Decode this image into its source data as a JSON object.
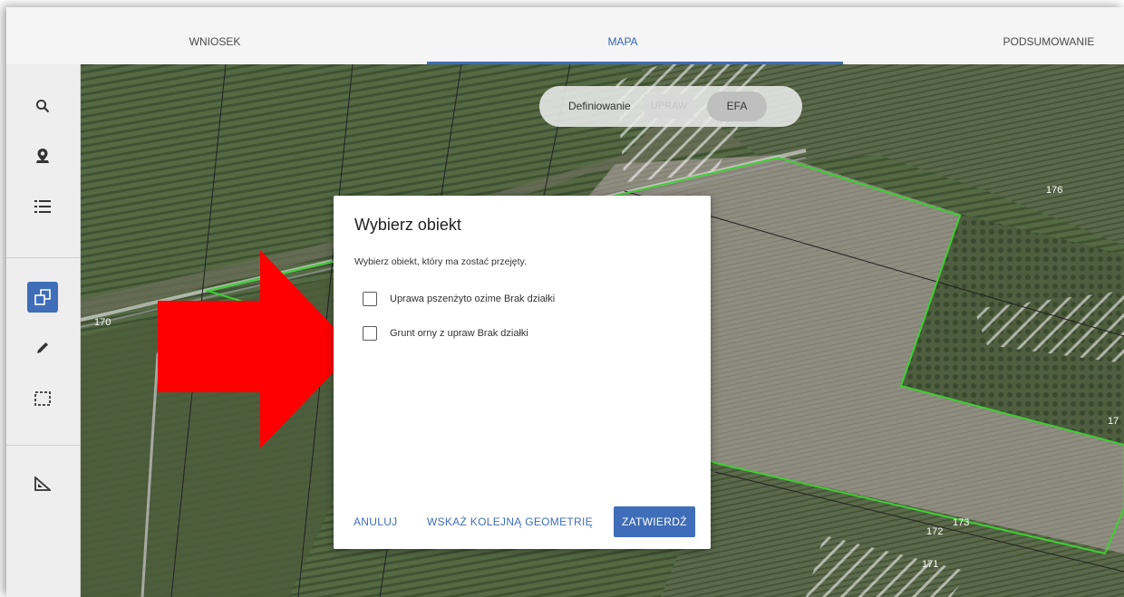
{
  "tabs": [
    {
      "label": "WNIOSEK"
    },
    {
      "label": "MAPA"
    },
    {
      "label": "PODSUMOWANIE"
    }
  ],
  "active_tab": "MAPA",
  "colors": {
    "accent": "#3f6db8",
    "parcel_outline": "#3ecf32",
    "arrow": "#ff0000"
  },
  "toolbar": {
    "tools": [
      "search-icon",
      "location-pin-icon",
      "list-icon",
      "copy-icon",
      "pencil-icon",
      "selection-icon",
      "ruler-icon"
    ],
    "active_tool": "copy-icon"
  },
  "mode_toggle": {
    "label": "Definiowanie",
    "options": [
      "UPRAW",
      "EFA"
    ],
    "selected": "EFA"
  },
  "map": {
    "parcel_labels": [
      "176",
      "170",
      "17",
      "172",
      "173",
      "171"
    ]
  },
  "dialog": {
    "title": "Wybierz obiekt",
    "subtitle": "Wybierz obiekt, który ma zostać przejęty.",
    "options": [
      {
        "label": "Uprawa pszenżyto ozime Brak działki",
        "checked": false
      },
      {
        "label": "Grunt orny z upraw Brak działki",
        "checked": false
      }
    ],
    "buttons": {
      "cancel": "ANULUJ",
      "next_geometry": "WSKAŻ KOLEJNĄ GEOMETRIĘ",
      "confirm": "ZATWIERDŹ"
    }
  }
}
